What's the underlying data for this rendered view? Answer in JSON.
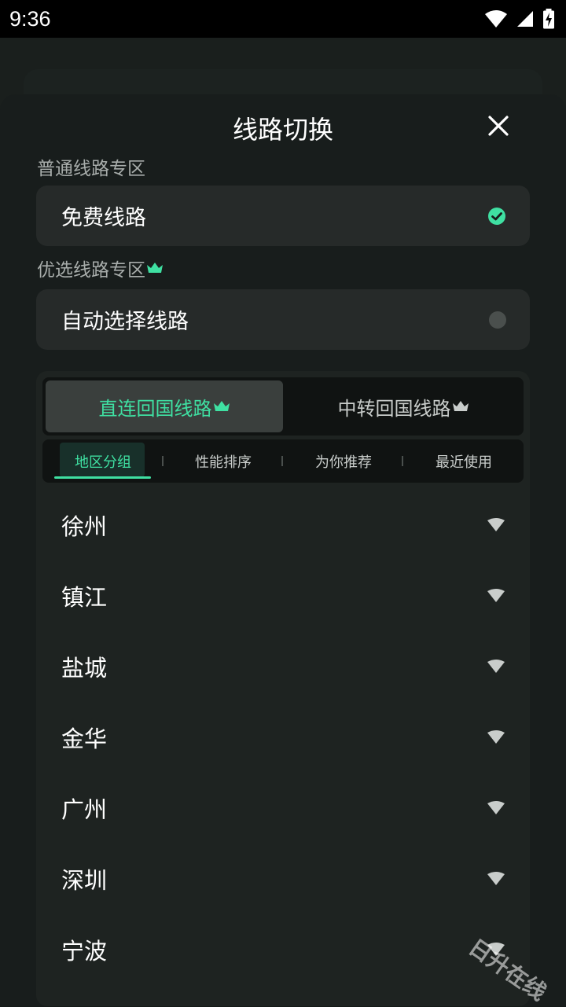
{
  "status_bar": {
    "time": "9:36"
  },
  "dialog": {
    "title": "线路切换",
    "normal_section_label": "普通线路专区",
    "free_option_label": "免费线路",
    "premium_section_label": "优选线路专区",
    "auto_option_label": "自动选择线路"
  },
  "main_tabs": [
    {
      "label": "直连回国线路",
      "active": true
    },
    {
      "label": "中转回国线路",
      "active": false
    }
  ],
  "sub_tabs": [
    {
      "label": "地区分组",
      "active": true
    },
    {
      "label": "性能排序",
      "active": false
    },
    {
      "label": "为你推荐",
      "active": false
    },
    {
      "label": "最近使用",
      "active": false
    }
  ],
  "cities": [
    "徐州",
    "镇江",
    "盐城",
    "金华",
    "广州",
    "深圳",
    "宁波"
  ],
  "watermark": "日升在线",
  "colors": {
    "accent": "#3fe0a2",
    "background": "#181d1c",
    "card": "#262a29",
    "muted_text": "#a8adab"
  },
  "icons": {
    "close": "close-icon",
    "selected": "check-circle-icon",
    "unselected": "radio-off-icon",
    "premium": "crown-icon",
    "row_signal": "wifi-signal-icon"
  }
}
